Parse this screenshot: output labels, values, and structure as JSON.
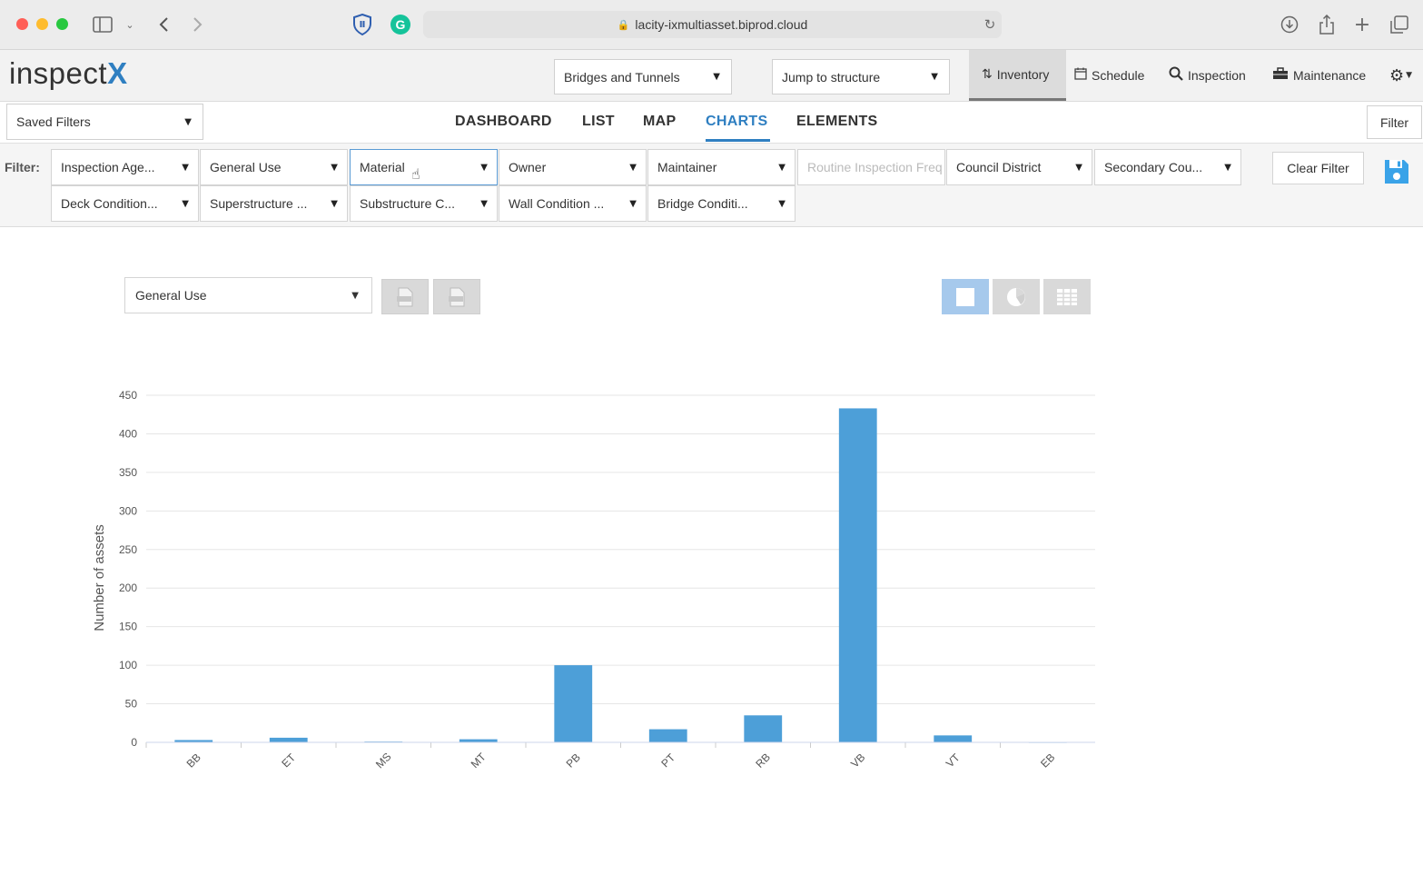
{
  "browser": {
    "url": "lacity-ixmultiasset.biprod.cloud"
  },
  "app": {
    "logo_text": "inspect",
    "logo_x": "X",
    "asset_type": "Bridges and Tunnels",
    "jump_to": "Jump to structure",
    "nav": [
      {
        "label": "Inventory",
        "icon": "sort-icon"
      },
      {
        "label": "Schedule",
        "icon": "calendar-icon"
      },
      {
        "label": "Inspection",
        "icon": "search-icon"
      },
      {
        "label": "Maintenance",
        "icon": "toolbox-icon"
      }
    ]
  },
  "saved_filters": "Saved Filters",
  "tabs": [
    "DASHBOARD",
    "LIST",
    "MAP",
    "CHARTS",
    "ELEMENTS"
  ],
  "active_tab": "CHARTS",
  "filter_button": "Filter",
  "filter_label": "Filter:",
  "filters_row1": [
    "Inspection Age...",
    "General Use",
    "Material",
    "Owner",
    "Maintainer",
    "Routine Inspection Freq",
    "Council District",
    "Secondary Cou..."
  ],
  "filters_row2": [
    "Deck Condition...",
    "Superstructure ...",
    "Substructure C...",
    "Wall Condition ...",
    "Bridge Conditi..."
  ],
  "clear_filter": "Clear Filter",
  "chart_group_by": "General Use",
  "colors": {
    "accent": "#2f7fc1",
    "bar": "#4d9fd8",
    "save": "#3aa3e8"
  },
  "chart_data": {
    "type": "bar",
    "categories": [
      "BB",
      "ET",
      "MS",
      "MT",
      "PB",
      "PT",
      "RB",
      "VB",
      "VT",
      "EB"
    ],
    "values": [
      3,
      6,
      1,
      4,
      100,
      17,
      35,
      433,
      9,
      0
    ],
    "title": "",
    "xlabel": "",
    "ylabel": "Number of assets",
    "ylim": [
      0,
      450
    ],
    "yticks": [
      0,
      50,
      100,
      150,
      200,
      250,
      300,
      350,
      400,
      450
    ],
    "grid": true
  }
}
